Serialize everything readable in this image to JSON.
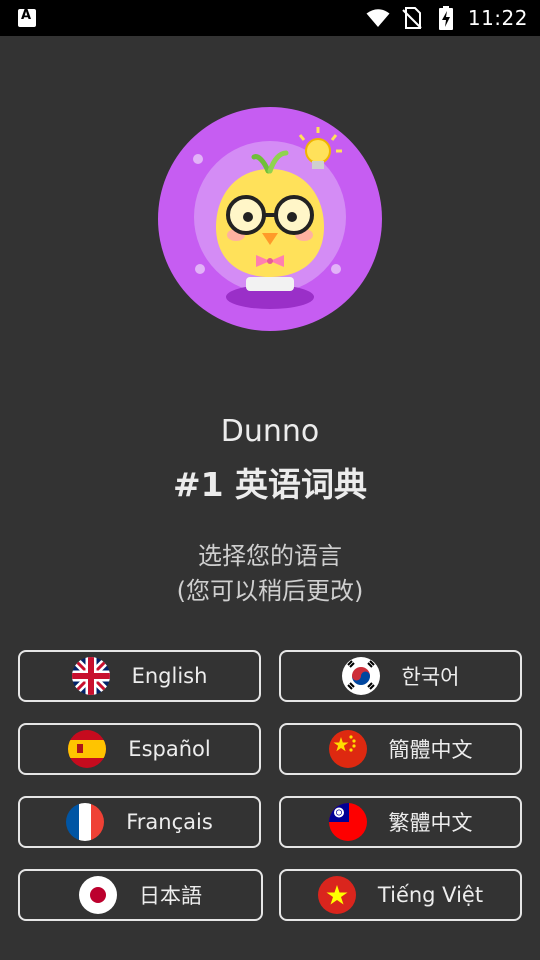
{
  "status": {
    "time": "11:22",
    "left_icon": "a-notification-icon",
    "icons": [
      "wifi-icon",
      "no-sim-icon",
      "battery-charging-icon"
    ]
  },
  "mascot": {
    "icon": "chick-with-glasses-mascot",
    "bg_color": "#c65df2"
  },
  "title": {
    "app_name": "Dunno",
    "tagline": "#1 英语词典"
  },
  "prompt": {
    "line1": "选择您的语言",
    "line2": "(您可以稍后更改)"
  },
  "languages": [
    {
      "label": "English",
      "flag": "uk-flag-icon"
    },
    {
      "label": "한국어",
      "flag": "korea-flag-icon"
    },
    {
      "label": "Español",
      "flag": "spain-flag-icon"
    },
    {
      "label": "簡體中文",
      "flag": "china-flag-icon"
    },
    {
      "label": "Français",
      "flag": "france-flag-icon"
    },
    {
      "label": "繁體中文",
      "flag": "taiwan-flag-icon"
    },
    {
      "label": "日本語",
      "flag": "japan-flag-icon"
    },
    {
      "label": "Tiếng Việt",
      "flag": "vietnam-flag-icon"
    }
  ]
}
